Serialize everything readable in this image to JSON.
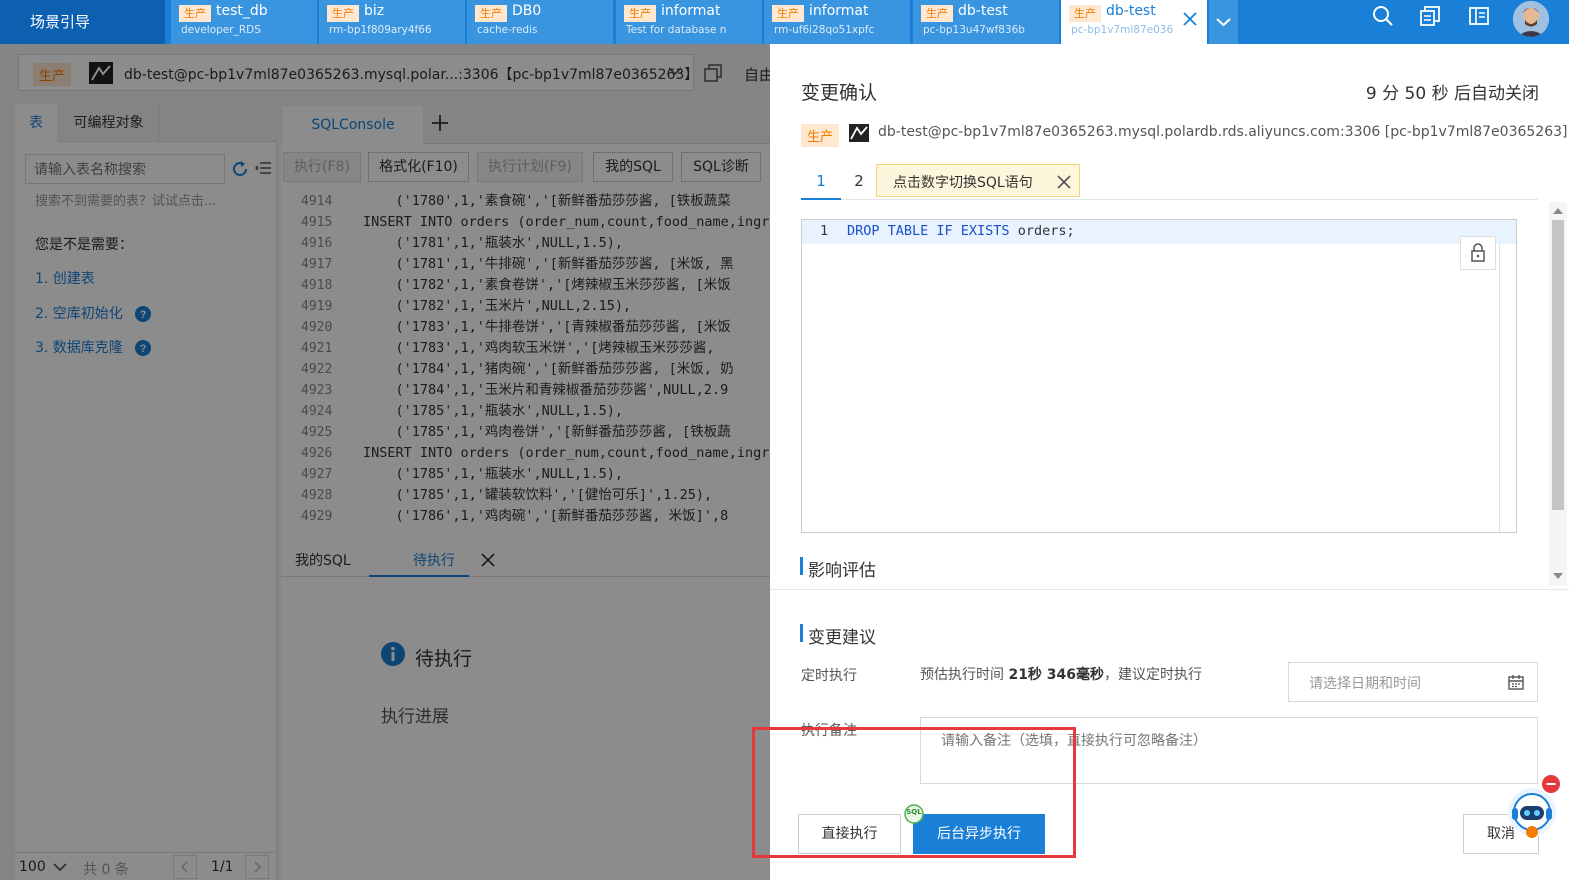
{
  "top_bar": {
    "guide_label": "场景引导",
    "tabs": [
      {
        "env": "生产",
        "name": "test_db",
        "sub": "developer_RDS"
      },
      {
        "env": "生产",
        "name": "biz",
        "sub": "rm-bp1f809ary4f66"
      },
      {
        "env": "生产",
        "name": "DB0",
        "sub": "cache-redis"
      },
      {
        "env": "生产",
        "name": "informat",
        "sub": "Test for database n"
      },
      {
        "env": "生产",
        "name": "informat",
        "sub": "rm-uf6i28qo51xpfc"
      },
      {
        "env": "生产",
        "name": "db-test",
        "sub": "pc-bp13u47wf836b"
      },
      {
        "env": "生产",
        "name": "db-test",
        "sub": "pc-bp1v7ml87e036"
      }
    ],
    "icons": [
      "search-icon",
      "layers-icon",
      "sidebar-icon",
      "avatar"
    ]
  },
  "connection": {
    "env": "生产",
    "label": "db-test@pc-bp1v7ml87e0365263.mysql.polar...:3306【pc-bp1v7ml87e0365263】",
    "extra": "自由"
  },
  "left_panel": {
    "tabs": [
      "表",
      "可编程对象"
    ],
    "search_placeholder": "请输入表名称搜索",
    "hint": "搜索不到需要的表？试试点击...",
    "need_title": "您是不是需要：",
    "options": [
      "1. 创建表",
      "2. 空库初始化",
      "3. 数据库克隆"
    ],
    "page_size": "100",
    "total": "共 0 条",
    "page": "1/1"
  },
  "editor": {
    "tab": "SQLConsole",
    "toolbar": [
      "执行(F8)",
      "格式化(F10)",
      "执行计划(F9)",
      "我的SQL",
      "SQL诊断"
    ],
    "lines": [
      {
        "n": "4914",
        "t": "    ('1780',1,'素食碗','[新鲜番茄莎莎酱, [铁板蔬菜"
      },
      {
        "n": "4915",
        "t": "INSERT INTO orders (order_num,count,food_name,ingr"
      },
      {
        "n": "4916",
        "t": "    ('1781',1,'瓶装水',NULL,1.5),"
      },
      {
        "n": "4917",
        "t": "    ('1781',1,'牛排碗','[新鲜番茄莎莎酱, [米饭, 黑"
      },
      {
        "n": "4918",
        "t": "    ('1782',1,'素食卷饼','[烤辣椒玉米莎莎酱, [米饭"
      },
      {
        "n": "4919",
        "t": "    ('1782',1,'玉米片',NULL,2.15),"
      },
      {
        "n": "4920",
        "t": "    ('1783',1,'牛排卷饼','[青辣椒番茄莎莎酱, [米饭"
      },
      {
        "n": "4921",
        "t": "    ('1783',1,'鸡肉软玉米饼','[烤辣椒玉米莎莎酱,"
      },
      {
        "n": "4922",
        "t": "    ('1784',1,'猪肉碗','[新鲜番茄莎莎酱, [米饭, 奶"
      },
      {
        "n": "4923",
        "t": "    ('1784',1,'玉米片和青辣椒番茄莎莎酱',NULL,2.9"
      },
      {
        "n": "4924",
        "t": "    ('1785',1,'瓶装水',NULL,1.5),"
      },
      {
        "n": "4925",
        "t": "    ('1785',1,'鸡肉卷饼','[新鲜番茄莎莎酱, [铁板蔬"
      },
      {
        "n": "4926",
        "t": "INSERT INTO orders (order_num,count,food_name,ingr"
      },
      {
        "n": "4927",
        "t": "    ('1785',1,'瓶装水',NULL,1.5),"
      },
      {
        "n": "4928",
        "t": "    ('1785',1,'罐装软饮料','[健怡可乐]',1.25),"
      },
      {
        "n": "4929",
        "t": "    ('1786',1,'鸡肉碗','[新鲜番茄莎莎酱, 米饭]',8"
      }
    ],
    "bottom_tabs": [
      "我的SQL",
      "待执行"
    ],
    "pending_title": "待执行",
    "progress_label": "执行进展"
  },
  "drawer": {
    "title": "变更确认",
    "countdown": "9 分 50 秒 后自动关闭",
    "env": "生产",
    "conn": "db-test@pc-bp1v7ml87e0365263.mysql.polardb.rds.aliyuncs.com:3306 [pc-bp1v7ml87e0365263]",
    "sql_tabs": [
      "1",
      "2"
    ],
    "tooltip": "点击数字切换SQL语句",
    "sql_line_no": "1",
    "sql_kw": "DROP TABLE IF EXISTS",
    "sql_rest": " orders;",
    "impact_title": "影响评估",
    "suggest_title": "变更建议",
    "schedule_label": "定时执行",
    "estimate_prefix": "预估执行时间 ",
    "estimate_value": "21秒 346毫秒",
    "estimate_suffix": "，建议定时执行",
    "date_placeholder": "请选择日期和时间",
    "note_label": "执行备注",
    "note_placeholder": "请输入备注（选填，直接执行可忽略备注）",
    "btn_direct": "直接执行",
    "btn_async": "后台异步执行",
    "btn_cancel": "取消",
    "sql_badge": "SQL"
  },
  "colors": {
    "primary": "#1a7fd6",
    "prod_tag": "#f47a00",
    "highlight": "#e5393b"
  }
}
